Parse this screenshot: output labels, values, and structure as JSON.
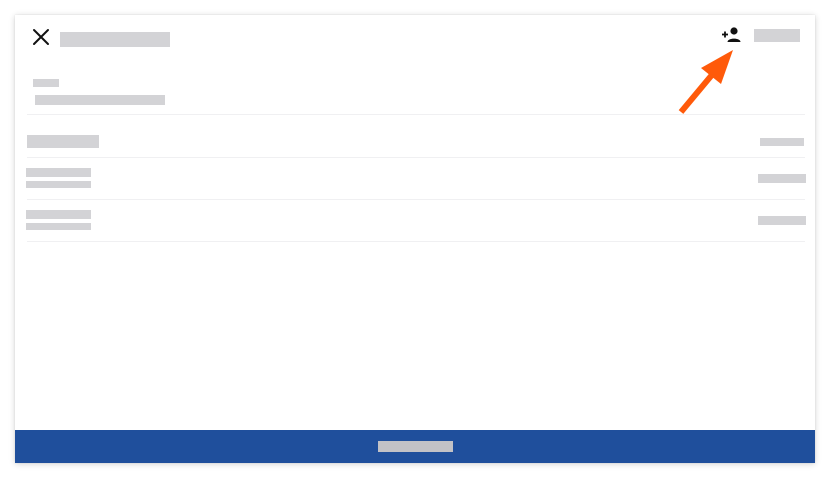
{
  "colors": {
    "accent_footer": "#1f4f9c",
    "annotation_arrow": "#ff5a0a",
    "placeholder_block": "#d3d3d6"
  },
  "icons": {
    "close": "close-icon",
    "add_user": "person-add-icon",
    "annotation": "arrow-annotation"
  }
}
